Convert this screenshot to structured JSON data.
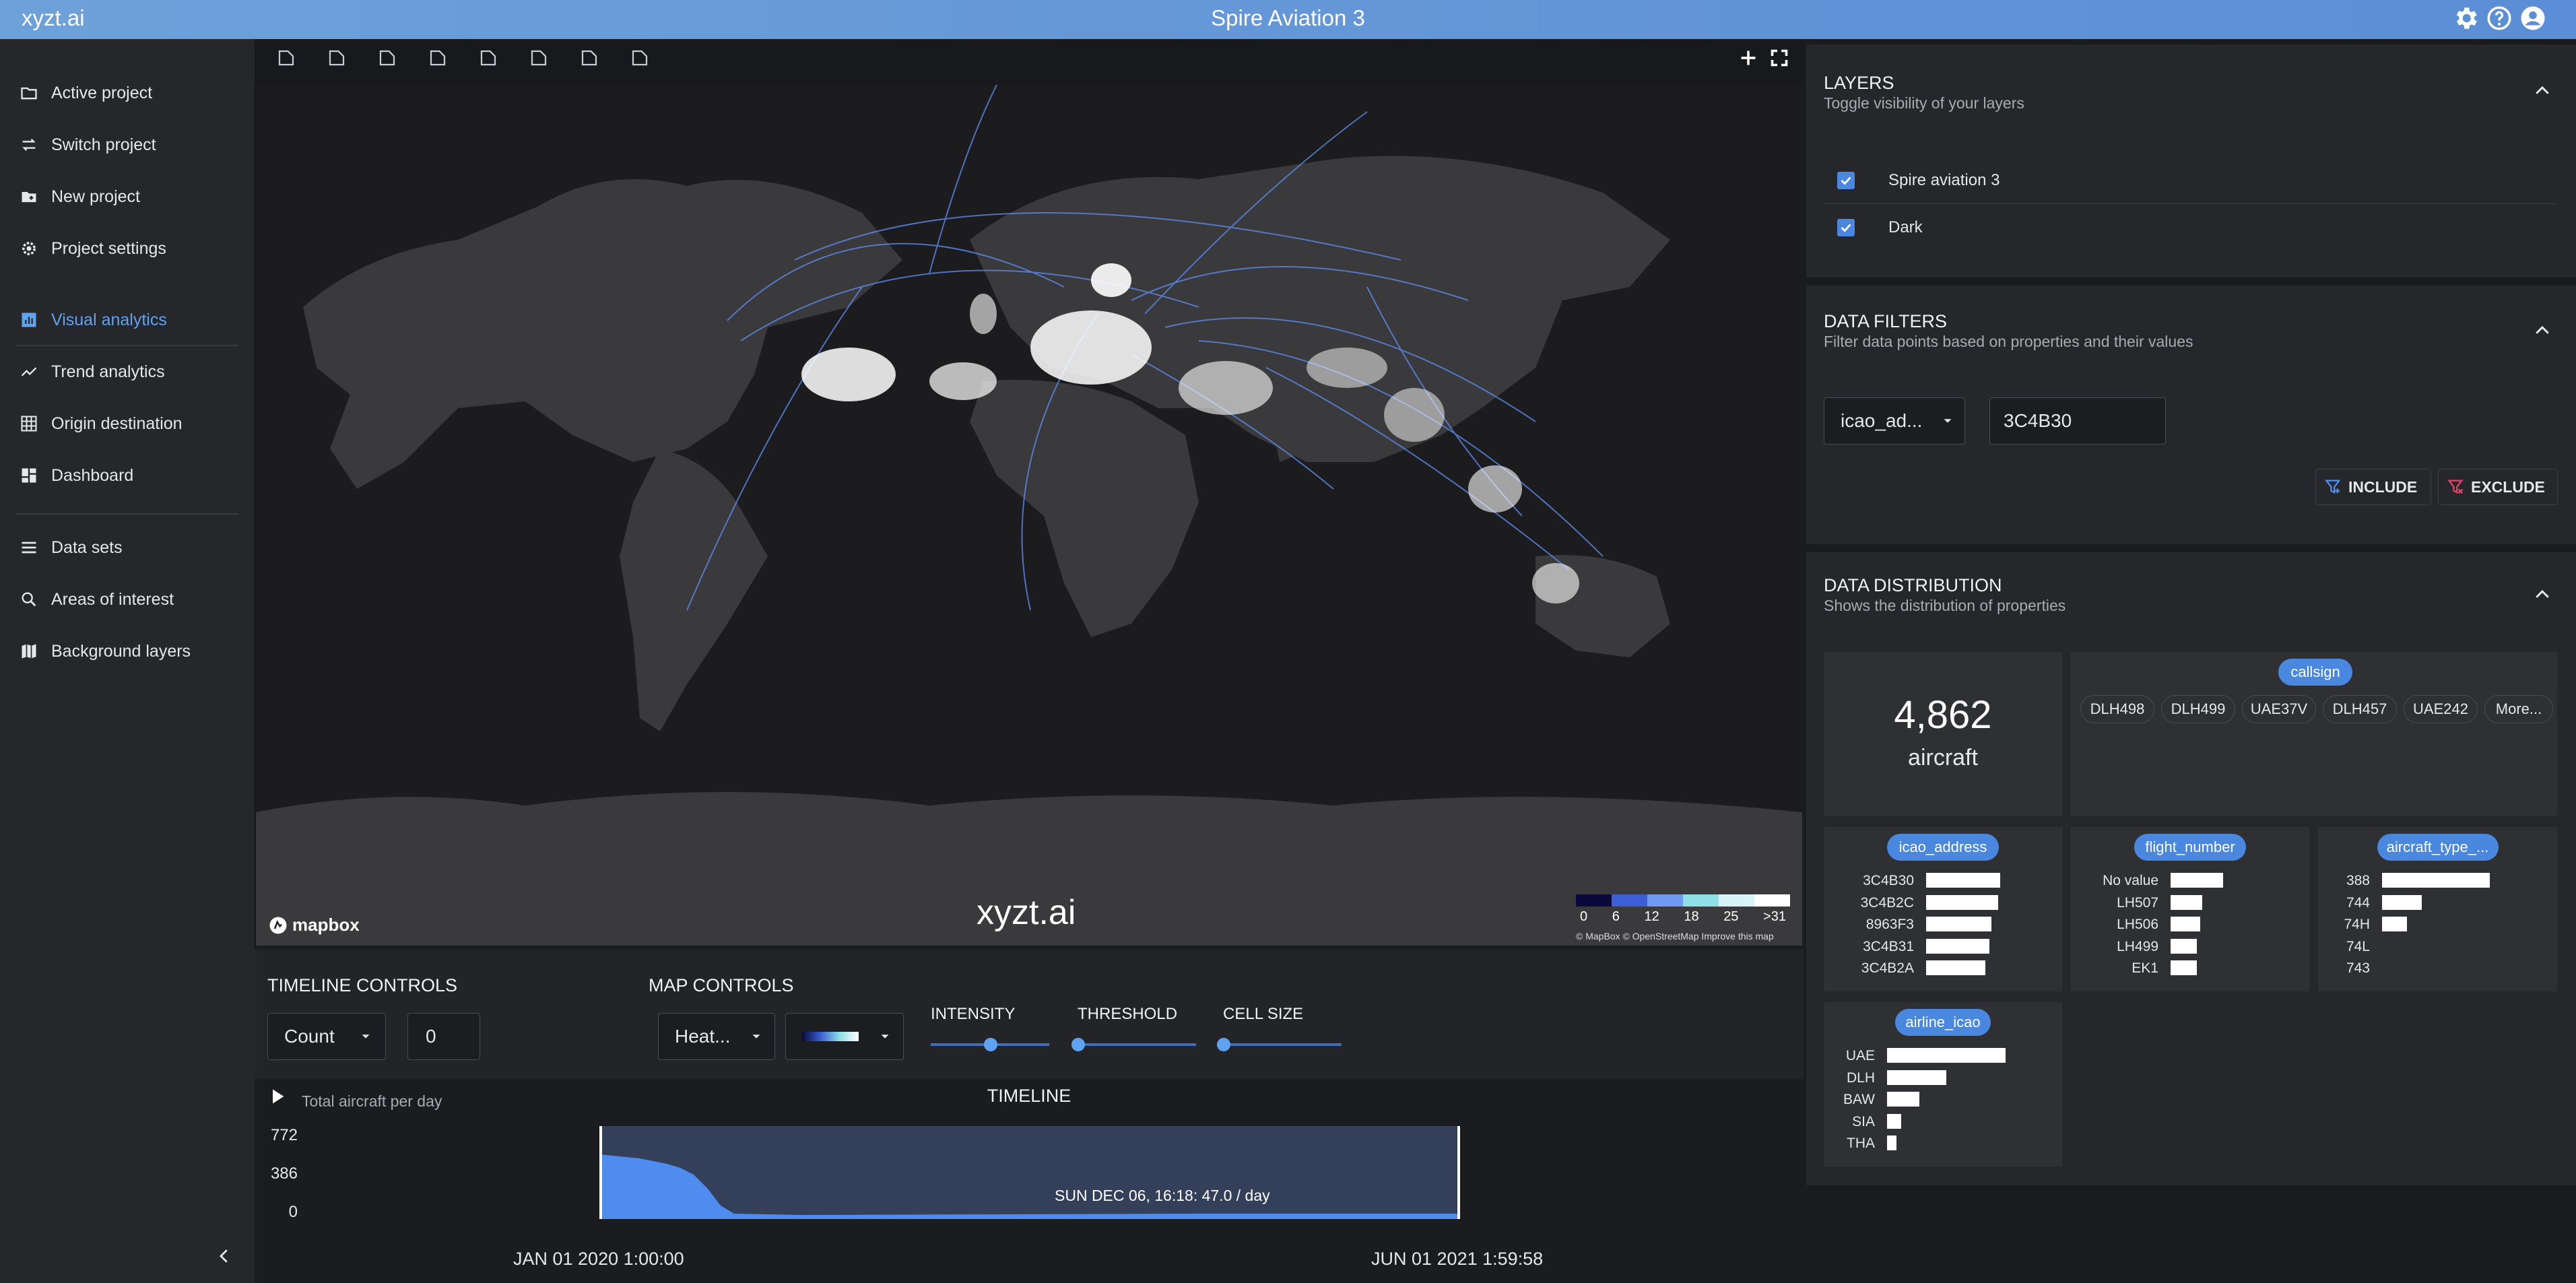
{
  "app": {
    "brand": "xyzt.ai",
    "title": "Spire Aviation 3"
  },
  "topbar_icons": [
    "gear-icon",
    "help-icon",
    "account-icon"
  ],
  "sidebar": {
    "items": [
      {
        "label": "Active project",
        "icon": "folder-icon"
      },
      {
        "label": "Switch project",
        "icon": "swap-icon"
      },
      {
        "label": "New project",
        "icon": "new-folder-icon"
      },
      {
        "label": "Project settings",
        "icon": "gear-icon"
      },
      {
        "label": "Visual analytics",
        "icon": "bar-chart-icon",
        "active": true
      },
      {
        "label": "Trend analytics",
        "icon": "trend-icon"
      },
      {
        "label": "Origin destination",
        "icon": "grid-icon"
      },
      {
        "label": "Dashboard",
        "icon": "dashboard-icon"
      },
      {
        "label": "Data sets",
        "icon": "list-icon"
      },
      {
        "label": "Areas of interest",
        "icon": "area-icon"
      },
      {
        "label": "Background layers",
        "icon": "map-icon"
      }
    ],
    "collapse_icon": "chevron-left-icon"
  },
  "map": {
    "tools": [
      "pan-icon",
      "select-icon",
      "pointer-icon",
      "polygon-icon",
      "crop-icon",
      "rotate-icon",
      "export-icon",
      "refresh-icon"
    ],
    "logo": "mapbox",
    "watermark": "xyzt.ai",
    "legend": {
      "labels": [
        "0",
        "6",
        "12",
        "18",
        "25",
        ">31"
      ],
      "colors": [
        "#0a0a3a",
        "#3c5fd6",
        "#6f9af0",
        "#8fe0e6",
        "#d8f4f8",
        "#ffffff"
      ]
    },
    "attribution": "© MapBox © OpenStreetMap Improve this map"
  },
  "timeline_controls": {
    "title": "TIMELINE CONTROLS",
    "metric": "Count",
    "value": "0"
  },
  "map_controls": {
    "title": "MAP CONTROLS",
    "viz": "Heat...",
    "sliders": [
      {
        "label": "INTENSITY",
        "level": 0.5
      },
      {
        "label": "THRESHOLD",
        "level": 0.0
      },
      {
        "label": "CELL SIZE",
        "level": 0.0
      }
    ]
  },
  "timeline": {
    "title": "TIMELINE",
    "caption": "Total aircraft per day",
    "y_ticks": [
      "772",
      "386",
      "0"
    ],
    "hover": "SUN DEC 06, 16:18: 47.0 / day",
    "start": "JAN 01 2020 1:00:00",
    "end": "JUN 01 2021 1:59:58"
  },
  "layers": {
    "title": "LAYERS",
    "subtitle": "Toggle visibility of your layers",
    "items": [
      {
        "label": "Spire aviation 3",
        "checked": true
      },
      {
        "label": "Dark",
        "checked": true
      }
    ]
  },
  "filters": {
    "title": "DATA FILTERS",
    "subtitle": "Filter data points based on properties and their values",
    "property": "icao_ad...",
    "value": "3C4B30",
    "include": "INCLUDE",
    "exclude": "EXCLUDE"
  },
  "distribution": {
    "title": "DATA DISTRIBUTION",
    "subtitle": "Shows the distribution of properties",
    "count": "4,862",
    "count_unit": "aircraft",
    "callsign": {
      "chip": "callsign",
      "values": [
        "DLH498",
        "DLH499",
        "UAE37V",
        "DLH457",
        "UAE242",
        "More..."
      ]
    },
    "icao_address": {
      "chip": "icao_address",
      "rows": [
        {
          "label": "3C4B30",
          "value": 1.0
        },
        {
          "label": "3C4B2C",
          "value": 0.97
        },
        {
          "label": "8963F3",
          "value": 0.88
        },
        {
          "label": "3C4B31",
          "value": 0.85
        },
        {
          "label": "3C4B2A",
          "value": 0.8
        }
      ]
    },
    "flight_number": {
      "chip": "flight_number",
      "rows": [
        {
          "label": "No value",
          "value": 1.0
        },
        {
          "label": "LH507",
          "value": 0.6
        },
        {
          "label": "LH506",
          "value": 0.57
        },
        {
          "label": "LH499",
          "value": 0.5
        },
        {
          "label": "EK1",
          "value": 0.5
        }
      ]
    },
    "aircraft_type": {
      "chip": "aircraft_type_...",
      "rows": [
        {
          "label": "388",
          "value": 1.0
        },
        {
          "label": "744",
          "value": 0.37
        },
        {
          "label": "74H",
          "value": 0.23
        },
        {
          "label": "74L",
          "value": 0.0
        },
        {
          "label": "743",
          "value": 0.0
        }
      ]
    },
    "airline_icao": {
      "chip": "airline_icao",
      "rows": [
        {
          "label": "UAE",
          "value": 1.0
        },
        {
          "label": "DLH",
          "value": 0.5
        },
        {
          "label": "BAW",
          "value": 0.27
        },
        {
          "label": "SIA",
          "value": 0.12
        },
        {
          "label": "THA",
          "value": 0.08
        }
      ]
    }
  }
}
